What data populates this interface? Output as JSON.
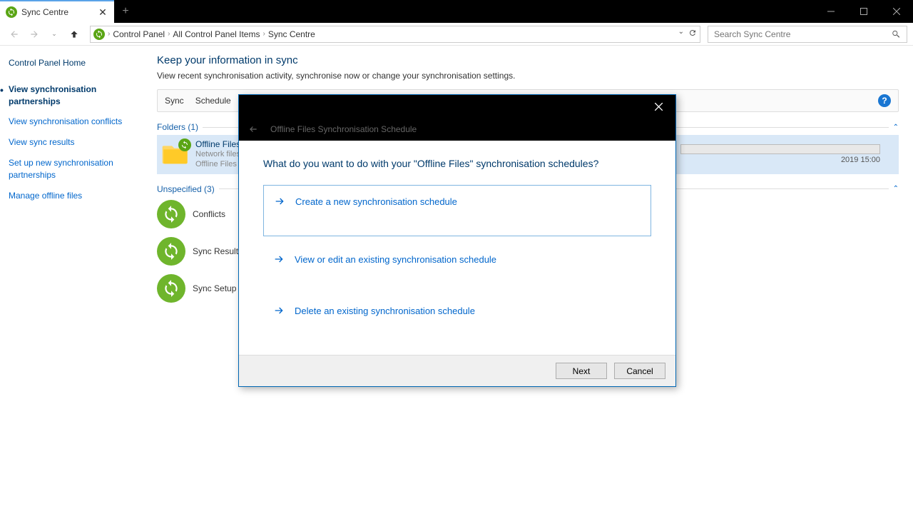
{
  "window": {
    "tab_title": "Sync Centre",
    "search_placeholder": "Search Sync Centre"
  },
  "breadcrumbs": [
    "Control Panel",
    "All Control Panel Items",
    "Sync Centre"
  ],
  "sidebar": {
    "links": [
      "Control Panel Home",
      "View synchronisation partnerships",
      "View synchronisation conflicts",
      "View sync results",
      "Set up new synchronisation partnerships",
      "Manage offline files"
    ],
    "active_index": 1
  },
  "page": {
    "title": "Keep your information in sync",
    "desc": "View recent synchronisation activity, synchronise now or change your synchronisation settings."
  },
  "toolbar_tabs": [
    "Sync",
    "Schedule"
  ],
  "groups": {
    "folders": {
      "label": "Folders (1)"
    },
    "unspecified": {
      "label": "Unspecified (3)"
    }
  },
  "offline_files": {
    "name": "Offline Files",
    "line2": "Network files",
    "line3": "Offline Files a",
    "progress_text": "2019 15:00"
  },
  "items": [
    "Conflicts",
    "Sync Results",
    "Sync Setup"
  ],
  "dialog": {
    "subtitle": "Offline Files Synchronisation Schedule",
    "question": "What do you want to do with your \"Offline Files\" synchronisation schedules?",
    "options": [
      "Create a new synchronisation schedule",
      "View or edit an existing synchronisation schedule",
      "Delete an existing synchronisation schedule"
    ],
    "next": "Next",
    "cancel": "Cancel"
  }
}
